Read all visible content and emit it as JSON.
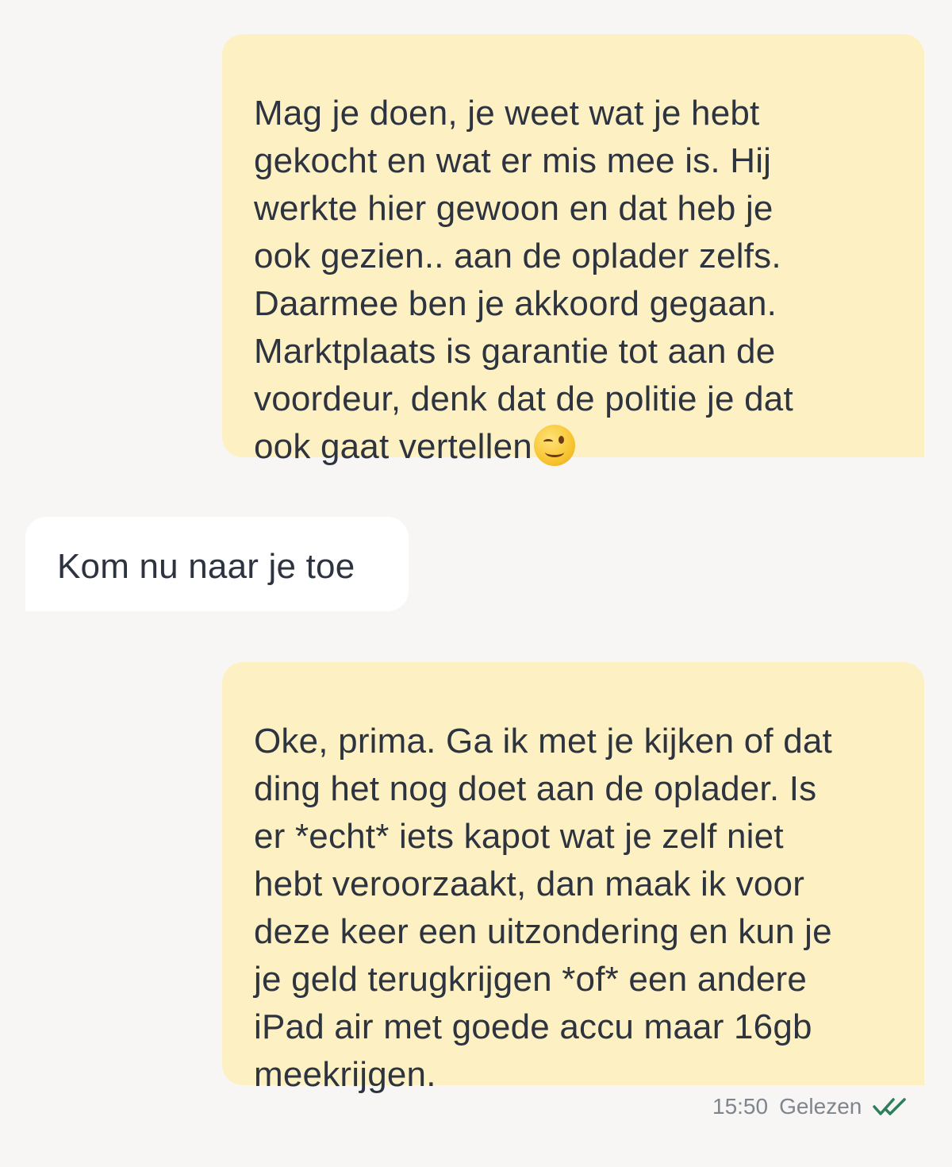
{
  "messages": [
    {
      "direction": "sent",
      "text": "Mag je doen, je weet wat je hebt\ngekocht en wat er mis mee is. Hij\nwerkte hier gewoon en dat heb je\nook gezien.. aan de oplader zelfs.\nDaarmee ben je akkoord gegaan.\nMarktplaats is garantie tot aan de\nvoordeur, denk dat de politie je dat\nook gaat vertellen",
      "emoji": "winking-face"
    },
    {
      "direction": "received",
      "text": "Kom nu naar je toe"
    },
    {
      "direction": "sent",
      "text": "Oke, prima. Ga ik met je kijken of dat\nding het nog doet aan de oplader. Is\ner *echt* iets kapot wat je zelf niet\nhebt veroorzaakt, dan maak ik voor\ndeze keer een uitzondering en kun je\nje geld terugkrijgen *of* een andere\niPad air met goede accu maar 16gb\nmeekrijgen."
    }
  ],
  "last_message_meta": {
    "time": "15:50",
    "status": "Gelezen",
    "status_icon": "double-check-icon",
    "status_icon_color": "#2e7d5b"
  },
  "colors": {
    "background": "#f7f6f4",
    "sent_bubble": "#fdf1c4",
    "received_bubble": "#ffffff",
    "text": "#2d3440",
    "meta_text": "#7e858f"
  }
}
